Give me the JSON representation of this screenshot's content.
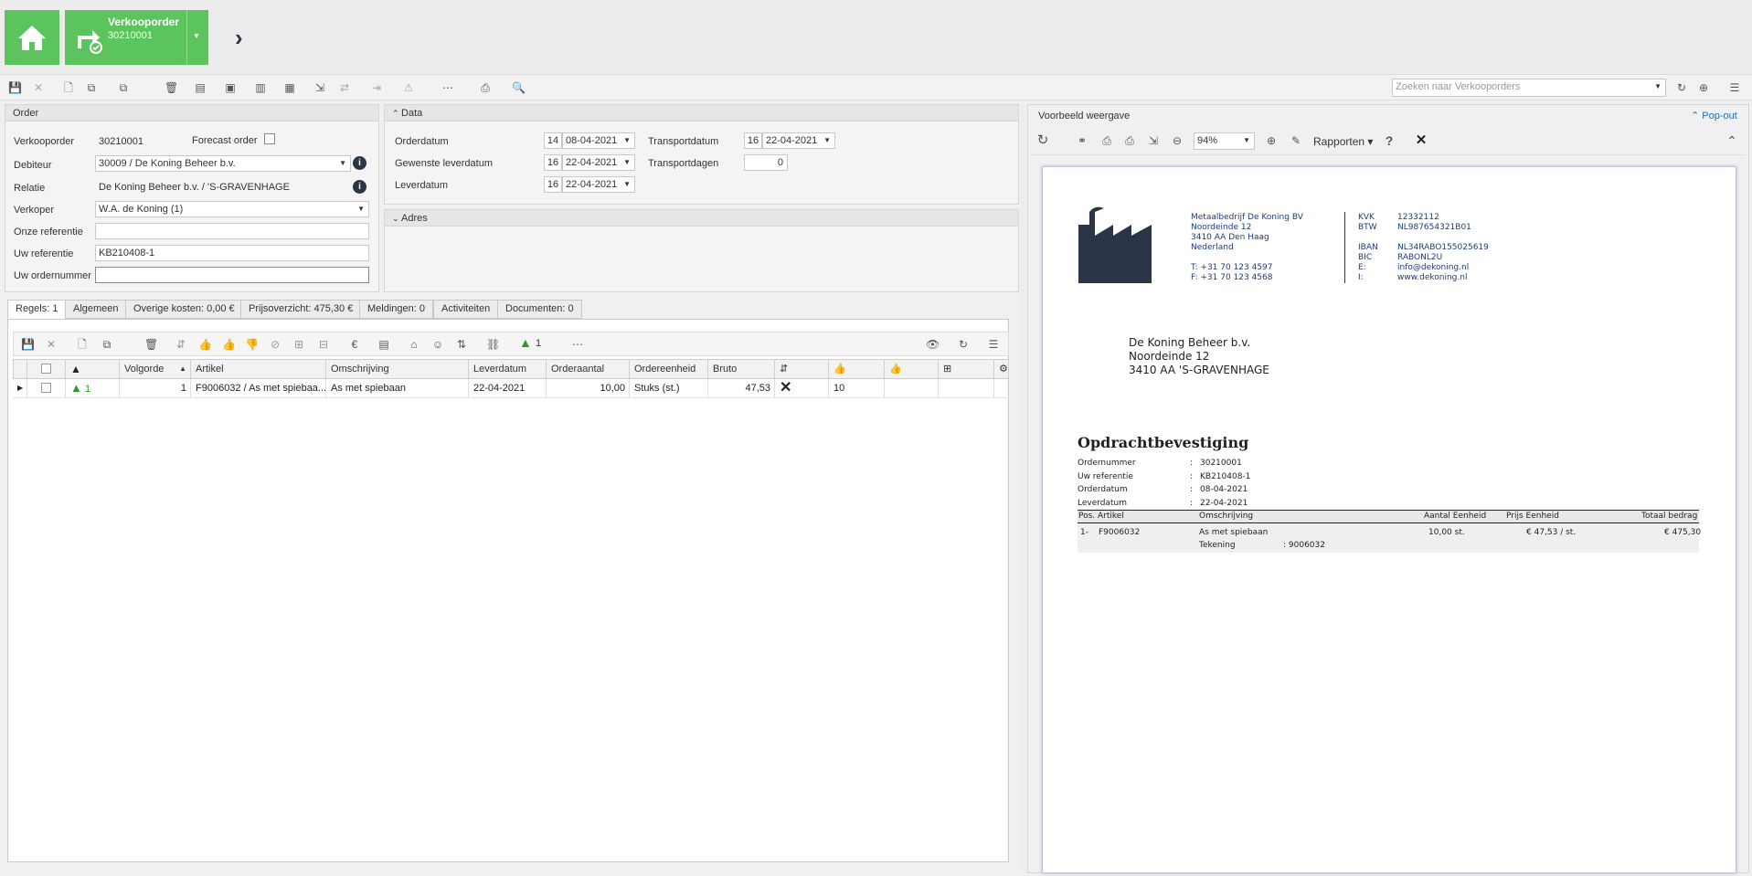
{
  "header": {
    "title": "Verkooporder",
    "subtitle": "30210001"
  },
  "search": {
    "placeholder": "Zoeken naar Verkooporders"
  },
  "order": {
    "title": "Order",
    "verkooporder_label": "Verkooporder",
    "verkooporder_value": "30210001",
    "forecast_label": "Forecast order",
    "debiteur_label": "Debiteur",
    "debiteur_value": "30009 / De Koning Beheer b.v.",
    "relatie_label": "Relatie",
    "relatie_value": "De Koning Beheer b.v. / 'S-GRAVENHAGE",
    "verkoper_label": "Verkoper",
    "verkoper_value": "W.A. de Koning (1)",
    "onze_ref_label": "Onze referentie",
    "onze_ref_value": "",
    "uw_ref_label": "Uw referentie",
    "uw_ref_value": "KB210408-1",
    "uw_order_label": "Uw ordernummer",
    "uw_order_value": ""
  },
  "data": {
    "title": "Data",
    "orderdatum_label": "Orderdatum",
    "orderdatum_week": "14",
    "orderdatum_value": "08-04-2021",
    "gewenste_label": "Gewenste leverdatum",
    "gewenste_week": "16",
    "gewenste_value": "22-04-2021",
    "leverdatum_label": "Leverdatum",
    "leverdatum_week": "16",
    "leverdatum_value": "22-04-2021",
    "transportdatum_label": "Transportdatum",
    "transportdatum_week": "16",
    "transportdatum_value": "22-04-2021",
    "transportdagen_label": "Transportdagen",
    "transportdagen_value": "0"
  },
  "adres": {
    "title": "Adres"
  },
  "tabs": [
    "Regels: 1",
    "Algemeen",
    "Overige kosten: 0,00 €",
    "Prijsoverzicht: 475,30 €",
    "Meldingen: 0",
    "Activiteiten",
    "Documenten: 0"
  ],
  "lines_toolbar": {
    "warning_count": "1"
  },
  "table": {
    "headers": [
      "Volgorde",
      "Artikel",
      "Omschrijving",
      "Leverdatum",
      "Orderaantal",
      "Ordereenheid",
      "Bruto"
    ],
    "row": {
      "warn": "1",
      "volgorde": "1",
      "artikel": "F9006032 / As met spiebaa...",
      "omschrijving": "As met spiebaan",
      "leverdatum": "22-04-2021",
      "orderaantal": "10,00",
      "ordereenheid": "Stuks (st.)",
      "bruto": "47,53",
      "col9": "10"
    }
  },
  "preview": {
    "title": "Voorbeeld weergave",
    "popout": "Pop-out",
    "zoom": "94%",
    "rapporten": "Rapporten",
    "company": [
      "Metaalbedrijf De Koning BV",
      "Noordeinde 12",
      "3410 AA  Den Haag",
      "Nederland"
    ],
    "phone": "T: +31 70 123 4597",
    "fax": "F: +31 70 123 4568",
    "kvk_label": "KVK",
    "kvk": "12332112",
    "btw_label": "BTW",
    "btw": "NL987654321B01",
    "iban_label": "IBAN",
    "iban": "NL34RABO155025619",
    "bic_label": "BIC",
    "bic": "RABONL2U",
    "email_label": "E:",
    "email": "info@dekoning.nl",
    "web_label": "I:",
    "web": "www.dekoning.nl",
    "address": [
      "De Koning Beheer b.v.",
      "Noordeinde 12",
      "3410 AA 'S-GRAVENHAGE"
    ],
    "doc_title": "Opdrachtbevestiging",
    "meta": [
      [
        "Ordernummer",
        ":",
        "30210001"
      ],
      [
        "Uw referentie",
        ":",
        "KB210408-1"
      ],
      [
        "Orderdatum",
        ":",
        "08-04-2021"
      ],
      [
        "Leverdatum",
        ":",
        "22-04-2021"
      ]
    ],
    "cols": [
      "Pos. Artikel",
      "Omschrijving",
      "Aantal Eenheid",
      "Prijs Eenheid",
      "Totaal bedrag"
    ],
    "line": {
      "pos": "1-",
      "artikel": "F9006032",
      "omschrijving": "As met spiebaan",
      "aantal": "10,00 st.",
      "prijs": "€ 47,53 / st.",
      "totaal": "€ 475,30",
      "tek_label": "Tekening",
      "tek_value": ": 9006032"
    }
  },
  "colors": {
    "green": "#5cc45c",
    "dark": "#2a3548",
    "accent": "#1f6fb5"
  }
}
